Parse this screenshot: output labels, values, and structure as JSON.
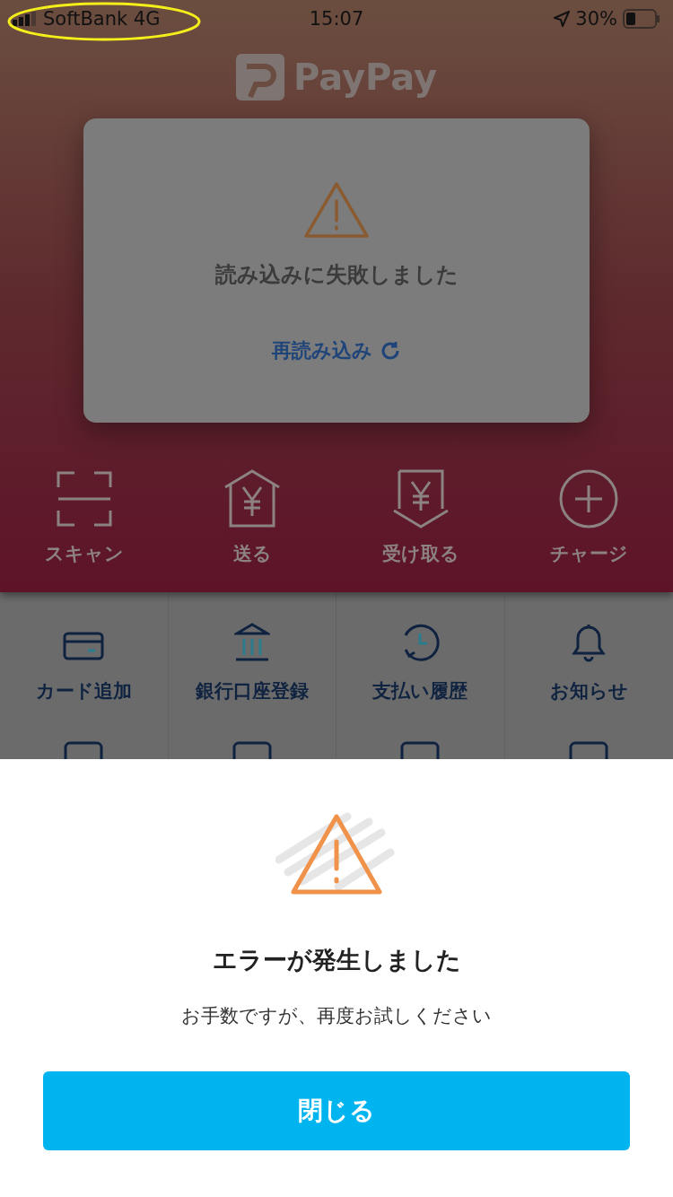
{
  "status_bar": {
    "carrier": "SoftBank 4G",
    "time": "15:07",
    "battery": "30%"
  },
  "header": {
    "logo": "PayPay"
  },
  "load_error_card": {
    "message": "読み込みに失敗しました",
    "retry": "再読み込み"
  },
  "actions": [
    {
      "label": "スキャン",
      "kind": "scan"
    },
    {
      "label": "送る",
      "kind": "send"
    },
    {
      "label": "受け取る",
      "kind": "receive"
    },
    {
      "label": "チャージ",
      "kind": "charge"
    }
  ],
  "menu": [
    {
      "label": "カード追加",
      "kind": "card"
    },
    {
      "label": "銀行口座登録",
      "kind": "bank"
    },
    {
      "label": "支払い履歴",
      "kind": "history"
    },
    {
      "label": "お知らせ",
      "kind": "bell"
    }
  ],
  "error_sheet": {
    "title": "エラーが発生しました",
    "message": "お手数ですが、再度お試しください",
    "button": "閉じる"
  }
}
